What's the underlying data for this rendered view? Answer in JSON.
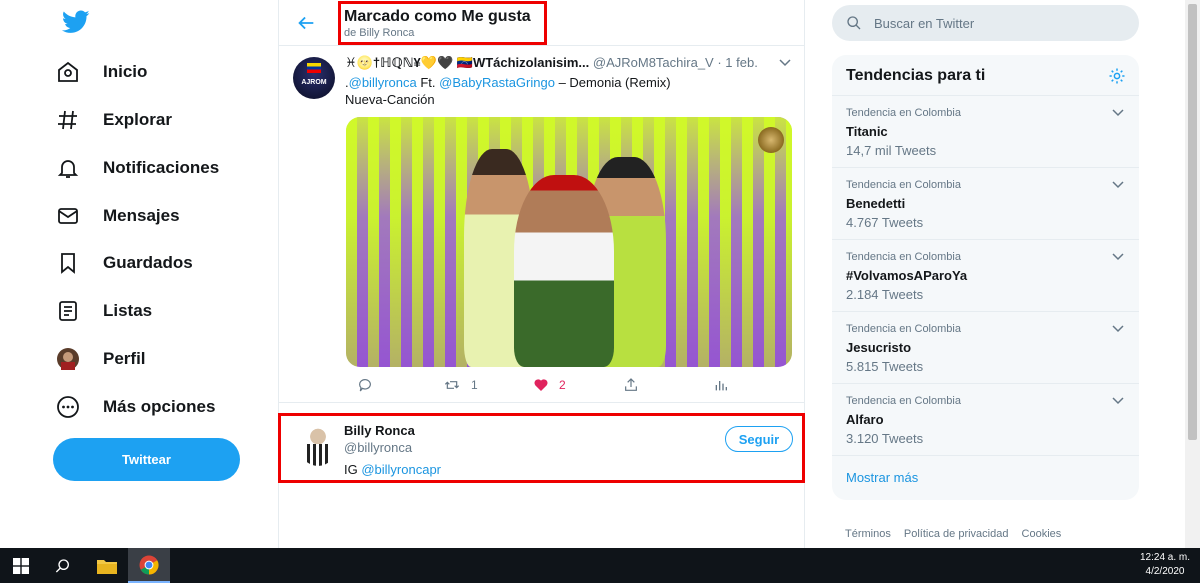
{
  "nav": {
    "items": [
      {
        "label": "Inicio",
        "icon": "home-icon"
      },
      {
        "label": "Explorar",
        "icon": "hashtag-icon"
      },
      {
        "label": "Notificaciones",
        "icon": "bell-icon"
      },
      {
        "label": "Mensajes",
        "icon": "envelope-icon"
      },
      {
        "label": "Guardados",
        "icon": "bookmark-icon"
      },
      {
        "label": "Listas",
        "icon": "list-icon"
      },
      {
        "label": "Perfil",
        "icon": "avatar-icon"
      },
      {
        "label": "Más opciones",
        "icon": "more-icon"
      }
    ],
    "tweet_button": "Twittear"
  },
  "header": {
    "title": "Marcado como Me gusta",
    "subtitle": "de Billy Ronca"
  },
  "tweet": {
    "username": "♓🌝†ℍℚℕ¥💛🖤 🇻🇪WTáchizolanisim...",
    "handle": "@AJRoM8Tachira_V",
    "date": "· 1 feb.",
    "body_prefix": ".",
    "mention1": "@billyronca",
    "ft": " Ft. ",
    "mention2": "@BabyRastaGringo",
    "body_suffix": " – Demonia (Remix)",
    "line2": "Nueva-Canción",
    "avatar_text": "AJROM",
    "retweets": "1",
    "likes": "2",
    "like_color": "#e0245e"
  },
  "user_card": {
    "name": "Billy Ronca",
    "handle": "@billyronca",
    "bio_prefix": "IG ",
    "bio_link": "@billyroncapr",
    "follow": "Seguir"
  },
  "search": {
    "placeholder": "Buscar en Twitter"
  },
  "trends": {
    "title": "Tendencias para ti",
    "items": [
      {
        "context": "Tendencia en Colombia",
        "topic": "Titanic",
        "count": "14,7 mil Tweets"
      },
      {
        "context": "Tendencia en Colombia",
        "topic": "Benedetti",
        "count": "4.767 Tweets"
      },
      {
        "context": "Tendencia en Colombia",
        "topic": "#VolvamosAParoYa",
        "count": "2.184 Tweets"
      },
      {
        "context": "Tendencia en Colombia",
        "topic": "Jesucristo",
        "count": "5.815 Tweets"
      },
      {
        "context": "Tendencia en Colombia",
        "topic": "Alfaro",
        "count": "3.120 Tweets"
      }
    ],
    "show_more": "Mostrar más"
  },
  "footer": {
    "terms": "Términos",
    "privacy": "Política de privacidad",
    "cookies": "Cookies"
  },
  "taskbar": {
    "time": "12:24 a. m.",
    "date": "4/2/2020"
  },
  "colors": {
    "accent": "#1da1f2",
    "highlight_box": "#ee0000"
  }
}
